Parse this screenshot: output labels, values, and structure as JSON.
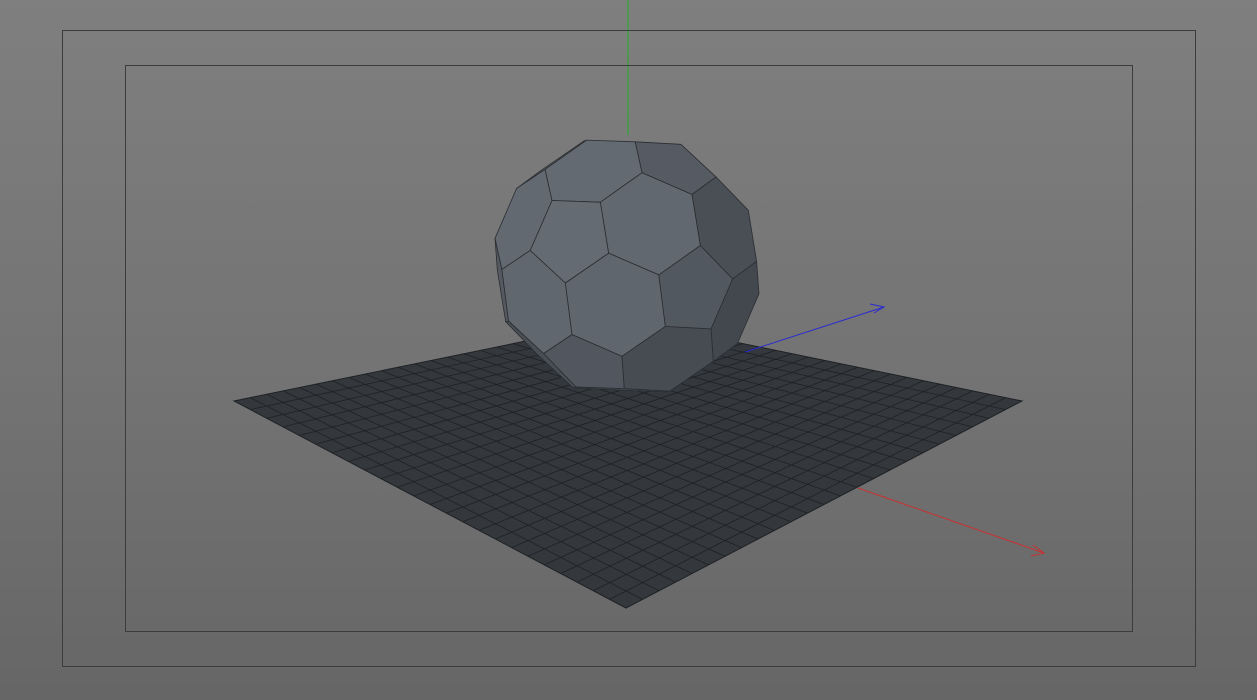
{
  "viewport": {
    "background_top": "#7f7f7f",
    "background_bottom": "#666666"
  },
  "axes": {
    "x_color": "#c83232",
    "y_color": "#22b022",
    "z_color": "#2a2ad0"
  },
  "floor": {
    "subdivisions": 24,
    "fill_color": "#34383d",
    "line_color": "#1e2124"
  },
  "sphere": {
    "type": "truncated-icosahedron",
    "light_face_color": "#8e939a",
    "mid_face_color": "#656b73",
    "dark_face_color": "#43484f",
    "edge_color": "#2a2d31"
  }
}
